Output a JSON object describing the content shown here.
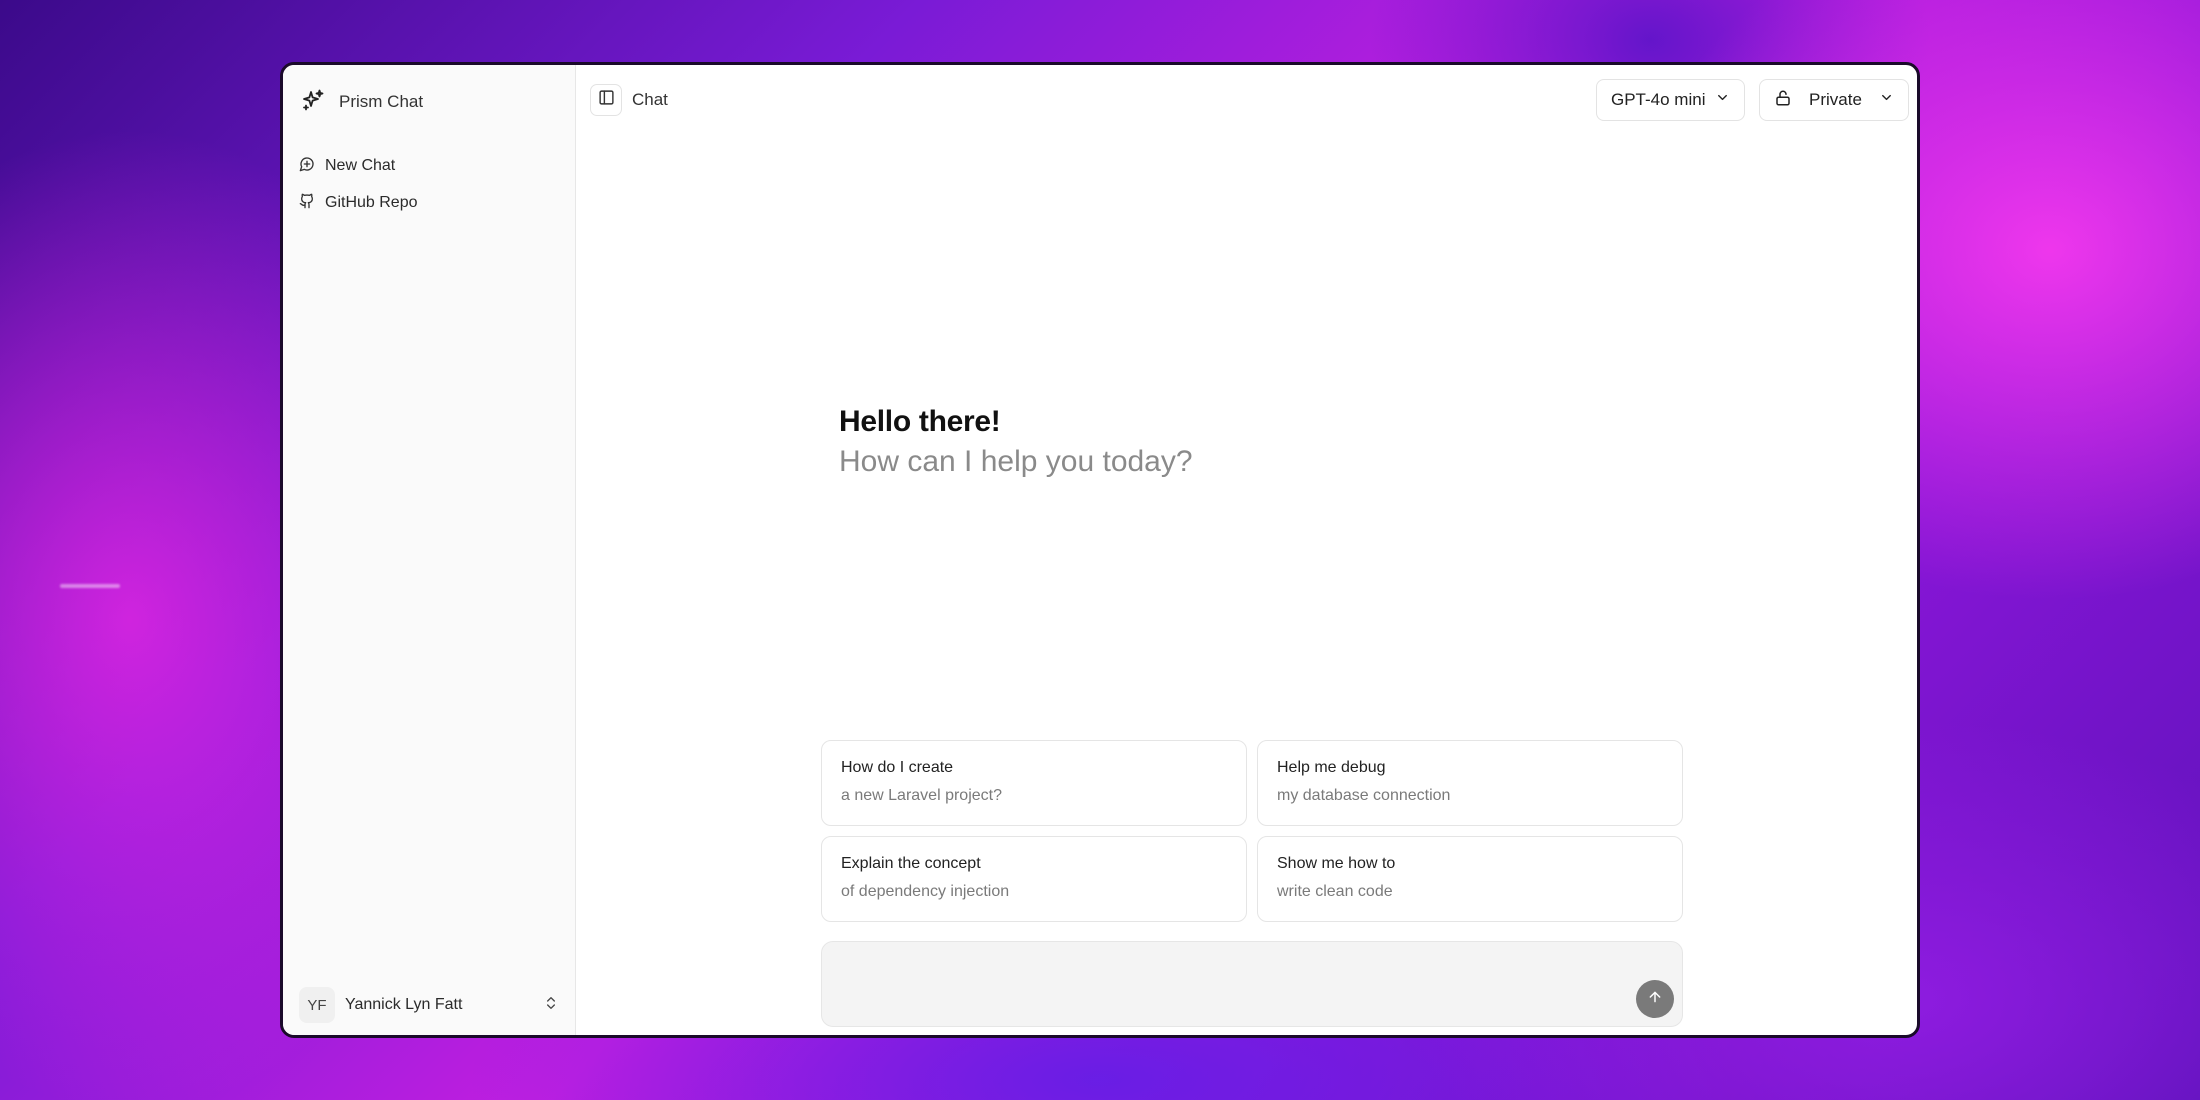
{
  "app": {
    "name": "Prism Chat"
  },
  "sidebar": {
    "items": [
      {
        "label": "New Chat",
        "icon": "new-chat-icon"
      },
      {
        "label": "GitHub Repo",
        "icon": "github-icon"
      }
    ],
    "user": {
      "initials": "YF",
      "name": "Yannick Lyn Fatt"
    }
  },
  "header": {
    "title": "Chat",
    "model": "GPT-4o mini",
    "visibility": "Private"
  },
  "greeting": {
    "title": "Hello there!",
    "subtitle": "How can I help you today?"
  },
  "suggestions": [
    {
      "title": "How do I create",
      "subtitle": "a new Laravel project?"
    },
    {
      "title": "Help me debug",
      "subtitle": "my database connection"
    },
    {
      "title": "Explain the concept",
      "subtitle": "of dependency injection"
    },
    {
      "title": "Show me how to",
      "subtitle": "write clean code"
    }
  ],
  "composer": {
    "value": "",
    "placeholder": ""
  },
  "colors": {
    "send_button": "#7a7a7a",
    "window_border": "#1a0a2a",
    "background_accent": "#c21fe0"
  }
}
